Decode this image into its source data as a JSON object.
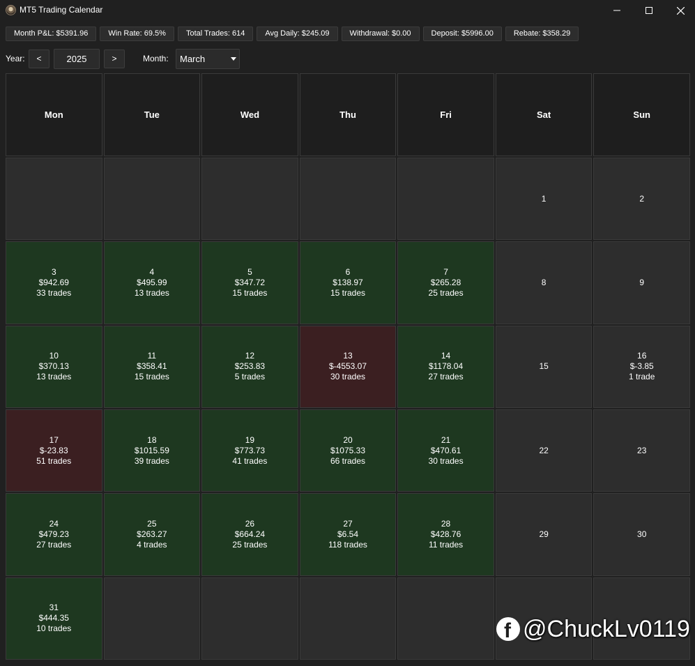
{
  "window": {
    "title": "MT5 Trading Calendar",
    "icon": "app-logo-icon",
    "controls": [
      "minimize-icon",
      "maximize-icon",
      "close-icon"
    ]
  },
  "stats": [
    {
      "name": "stat-month-pnl",
      "label": "Month P&L: $5391.96"
    },
    {
      "name": "stat-win-rate",
      "label": "Win Rate: 69.5%"
    },
    {
      "name": "stat-total-trades",
      "label": "Total Trades: 614"
    },
    {
      "name": "stat-avg-daily",
      "label": "Avg Daily: $245.09"
    },
    {
      "name": "stat-withdrawal",
      "label": "Withdrawal: $0.00"
    },
    {
      "name": "stat-deposit",
      "label": "Deposit: $5996.00"
    },
    {
      "name": "stat-rebate",
      "label": "Rebate: $358.29"
    }
  ],
  "nav": {
    "year_label": "Year:",
    "prev_label": "<",
    "year_value": "2025",
    "next_label": ">",
    "month_label": "Month:",
    "month_value": "March"
  },
  "weekdays": [
    "Mon",
    "Tue",
    "Wed",
    "Thu",
    "Fri",
    "Sat",
    "Sun"
  ],
  "colors": {
    "profit": "#1e3820",
    "loss": "#3b1f21",
    "neutral": "#2d2d2d"
  },
  "days": [
    null,
    null,
    null,
    null,
    null,
    {
      "day": "1",
      "pnl": "",
      "trades": "",
      "status": "neutral"
    },
    {
      "day": "2",
      "pnl": "",
      "trades": "",
      "status": "neutral"
    },
    {
      "day": "3",
      "pnl": "$942.69",
      "trades": "33 trades",
      "status": "profit"
    },
    {
      "day": "4",
      "pnl": "$495.99",
      "trades": "13 trades",
      "status": "profit"
    },
    {
      "day": "5",
      "pnl": "$347.72",
      "trades": "15 trades",
      "status": "profit"
    },
    {
      "day": "6",
      "pnl": "$138.97",
      "trades": "15 trades",
      "status": "profit"
    },
    {
      "day": "7",
      "pnl": "$265.28",
      "trades": "25 trades",
      "status": "profit"
    },
    {
      "day": "8",
      "pnl": "",
      "trades": "",
      "status": "neutral"
    },
    {
      "day": "9",
      "pnl": "",
      "trades": "",
      "status": "neutral"
    },
    {
      "day": "10",
      "pnl": "$370.13",
      "trades": "13 trades",
      "status": "profit"
    },
    {
      "day": "11",
      "pnl": "$358.41",
      "trades": "15 trades",
      "status": "profit"
    },
    {
      "day": "12",
      "pnl": "$253.83",
      "trades": "5 trades",
      "status": "profit"
    },
    {
      "day": "13",
      "pnl": "$-4553.07",
      "trades": "30 trades",
      "status": "loss"
    },
    {
      "day": "14",
      "pnl": "$1178.04",
      "trades": "27 trades",
      "status": "profit"
    },
    {
      "day": "15",
      "pnl": "",
      "trades": "",
      "status": "neutral"
    },
    {
      "day": "16",
      "pnl": "$-3.85",
      "trades": "1 trade",
      "status": "neutral"
    },
    {
      "day": "17",
      "pnl": "$-23.83",
      "trades": "51 trades",
      "status": "loss"
    },
    {
      "day": "18",
      "pnl": "$1015.59",
      "trades": "39 trades",
      "status": "profit"
    },
    {
      "day": "19",
      "pnl": "$773.73",
      "trades": "41 trades",
      "status": "profit"
    },
    {
      "day": "20",
      "pnl": "$1075.33",
      "trades": "66 trades",
      "status": "profit"
    },
    {
      "day": "21",
      "pnl": "$470.61",
      "trades": "30 trades",
      "status": "profit"
    },
    {
      "day": "22",
      "pnl": "",
      "trades": "",
      "status": "neutral"
    },
    {
      "day": "23",
      "pnl": "",
      "trades": "",
      "status": "neutral"
    },
    {
      "day": "24",
      "pnl": "$479.23",
      "trades": "27 trades",
      "status": "profit"
    },
    {
      "day": "25",
      "pnl": "$263.27",
      "trades": "4 trades",
      "status": "profit"
    },
    {
      "day": "26",
      "pnl": "$664.24",
      "trades": "25 trades",
      "status": "profit"
    },
    {
      "day": "27",
      "pnl": "$6.54",
      "trades": "118 trades",
      "status": "profit"
    },
    {
      "day": "28",
      "pnl": "$428.76",
      "trades": "11 trades",
      "status": "profit"
    },
    {
      "day": "29",
      "pnl": "",
      "trades": "",
      "status": "neutral"
    },
    {
      "day": "30",
      "pnl": "",
      "trades": "",
      "status": "neutral"
    },
    {
      "day": "31",
      "pnl": "$444.35",
      "trades": "10 trades",
      "status": "profit"
    },
    null,
    null,
    null,
    null,
    null,
    null
  ],
  "watermark": {
    "icon": "facebook-icon",
    "text": "@ChuckLv0119"
  }
}
